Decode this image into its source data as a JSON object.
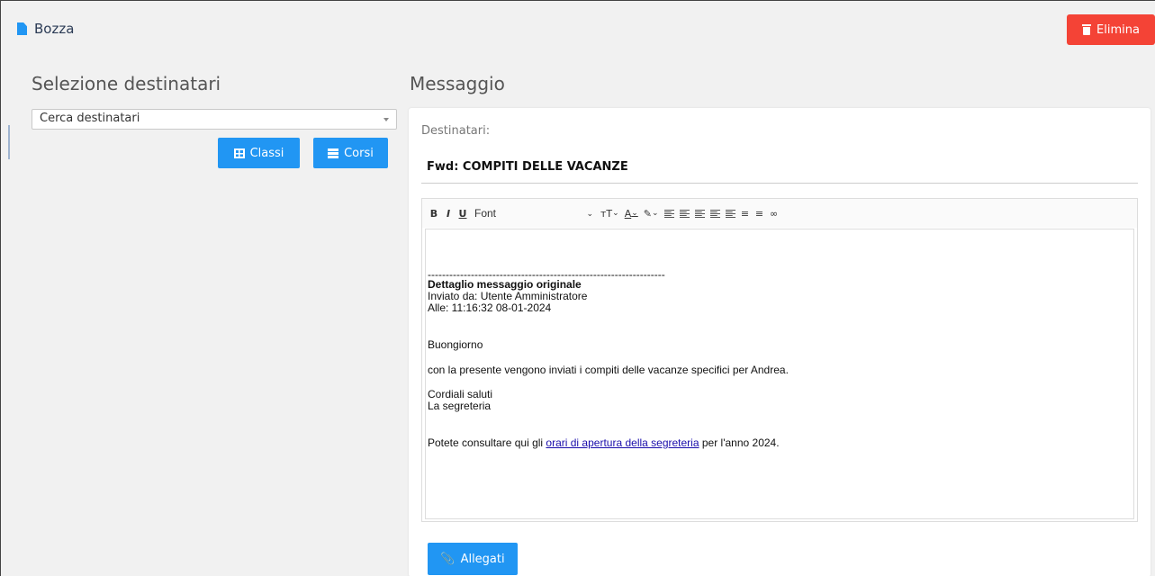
{
  "header": {
    "doc_title": "Bozza",
    "delete_label": "Elimina",
    "colors": {
      "accent": "#2196f3",
      "danger": "#f44336"
    }
  },
  "left": {
    "title": "Selezione destinatari",
    "search_placeholder": "Cerca destinatari",
    "classes_label": "Classi",
    "courses_label": "Corsi"
  },
  "message": {
    "title": "Messaggio",
    "recipients_label": "Destinatari:",
    "subject": "Fwd: COMPITI DELLE VACANZE",
    "toolbar": {
      "bold": "B",
      "italic": "I",
      "underline": "U",
      "font": "Font",
      "icons": [
        "bold-icon",
        "italic-icon",
        "underline-icon",
        "font-size-icon",
        "font-color-icon",
        "highlight-icon",
        "align-left-icon",
        "align-center-icon",
        "align-right-icon",
        "outdent-icon",
        "indent-icon",
        "bullet-list-icon",
        "numbered-list-icon",
        "link-icon"
      ]
    },
    "body": {
      "separator": "------------------------------------------------------------------",
      "detail_heading": "Dettaglio messaggio originale",
      "sent_by": "Inviato da: Utente Amministratore",
      "sent_at": "Alle: 11:16:32 08-01-2024",
      "greeting": "Buongiorno",
      "line1": "con la presente vengono inviati i compiti delle vacanze specifici per Andrea.",
      "closing1": "Cordiali saluti",
      "closing2": "La segreteria",
      "link_prefix": "Potete consultare qui gli ",
      "link_text": "orari di apertura della segreteria",
      "link_suffix": " per l'anno 2024."
    },
    "attachments_label": "Allegati"
  }
}
